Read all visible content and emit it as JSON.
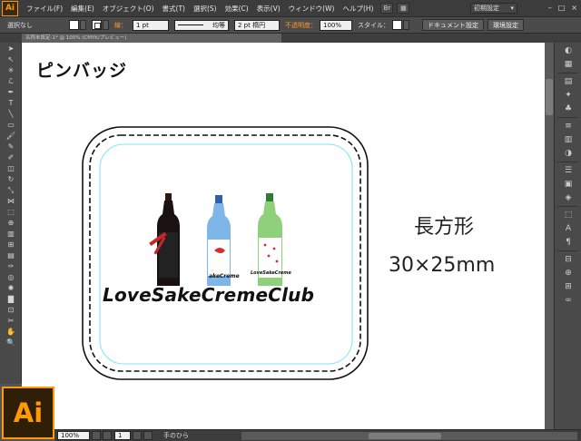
{
  "menubar": {
    "app_logo": "Ai",
    "items": [
      "ファイル(F)",
      "編集(E)",
      "オブジェクト(O)",
      "書式(T)",
      "選択(S)",
      "効果(C)",
      "表示(V)",
      "ウィンドウ(W)",
      "ヘルプ(H)"
    ],
    "workspace": "初期設定",
    "window_controls": [
      "–",
      "□",
      "×"
    ]
  },
  "controlbar": {
    "selection": "選択なし",
    "stroke_label": "線：",
    "stroke_width": "1 pt",
    "stroke_profile": "均等",
    "brush": "2 pt 楕円",
    "opacity_label": "不透明度：",
    "opacity_value": "100%",
    "style_label": "スタイル：",
    "doc_setup": "ドキュメント設定",
    "preferences": "環境設定"
  },
  "tab": {
    "label": "名称未設定-1* @ 100% (CMYK/プレビュー)"
  },
  "artboard": {
    "title": "ピンバッジ",
    "shape": "長方形",
    "size": "30×25mm",
    "brand": "LoveSakeCremeClub",
    "bottle_labels": [
      "akeCreme",
      "LoveSakeCreme"
    ]
  },
  "statusbar": {
    "zoom": "100%",
    "page": "1",
    "tool": "手のひら"
  },
  "badge": {
    "label": "Ai"
  },
  "colors": {
    "accent": "#ff9a00",
    "guide": "#7fe3f5"
  }
}
